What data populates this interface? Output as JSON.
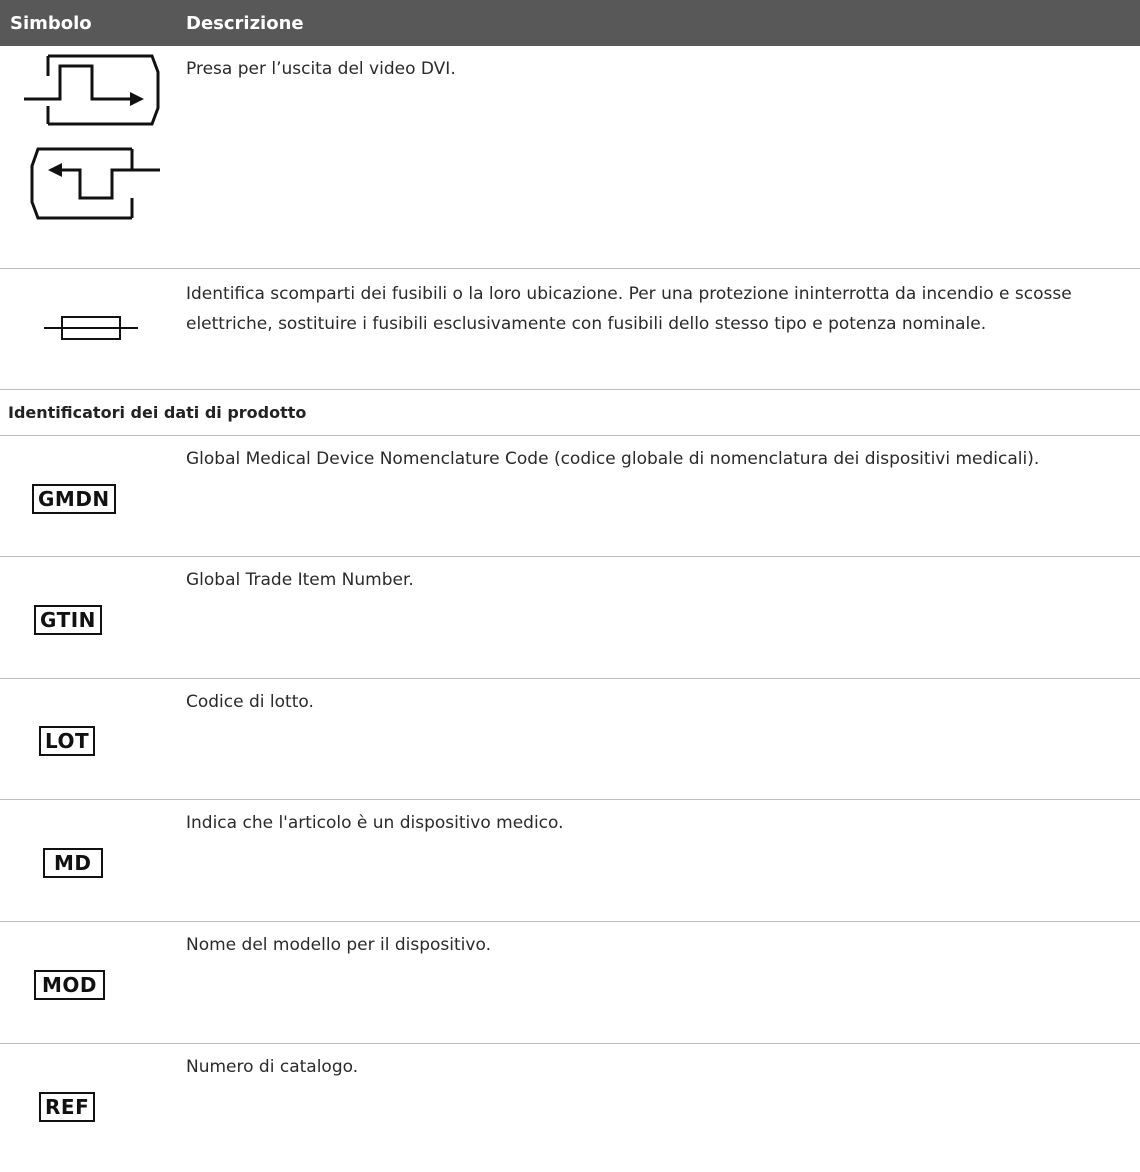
{
  "header": {
    "col_symbol": "Simbolo",
    "col_description": "Descrizione"
  },
  "rows_top": [
    {
      "icon": "dvi-video-output-icon",
      "description": "Presa per l’uscita del video DVI."
    },
    {
      "icon": "fuse-icon",
      "description": "Identifica scomparti dei fusibili o la loro ubicazione. Per una protezione ininterrotta da incendio e scosse elettriche, sostituire i fusibili esclusivamente con fusibili dello stesso tipo e potenza nominale."
    }
  ],
  "section_title": "Identificatori dei dati di prodotto",
  "rows_ids": [
    {
      "label": "GMDN",
      "description": "Global Medical Device Nomenclature Code (codice globale di nomenclatura dei dispositivi medicali)."
    },
    {
      "label": "GTIN",
      "description": "Global Trade Item Number."
    },
    {
      "label": "LOT",
      "description": "Codice di lotto."
    },
    {
      "label": "MD",
      "description": "Indica che l'articolo è un dispositivo medico."
    },
    {
      "label": "MOD",
      "description": "Nome del modello per il dispositivo."
    },
    {
      "label": "REF",
      "description": "Numero di catalogo."
    }
  ]
}
